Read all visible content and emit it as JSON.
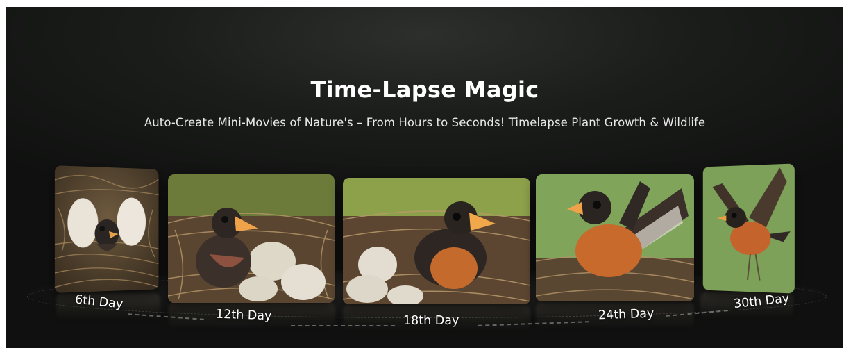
{
  "hero": {
    "title": "Time-Lapse Magic",
    "subtitle": "Auto-Create Mini-Movies of Nature's – From Hours to Seconds!  Timelapse Plant Growth & Wildlife"
  },
  "stages": [
    {
      "label": "6th Day",
      "image": "hatching-chick-in-eggshell-nest"
    },
    {
      "label": "12th Day",
      "image": "nestling-with-eggs"
    },
    {
      "label": "18th Day",
      "image": "feathered-nestling-in-nest"
    },
    {
      "label": "24th Day",
      "image": "fledgling-spreading-wings"
    },
    {
      "label": "30th Day",
      "image": "adult-robin-in-flight"
    }
  ],
  "colors": {
    "background": "#161816",
    "text": "#ffffff",
    "robin_breast": "#c8642a",
    "nest": "#8a6a45"
  }
}
